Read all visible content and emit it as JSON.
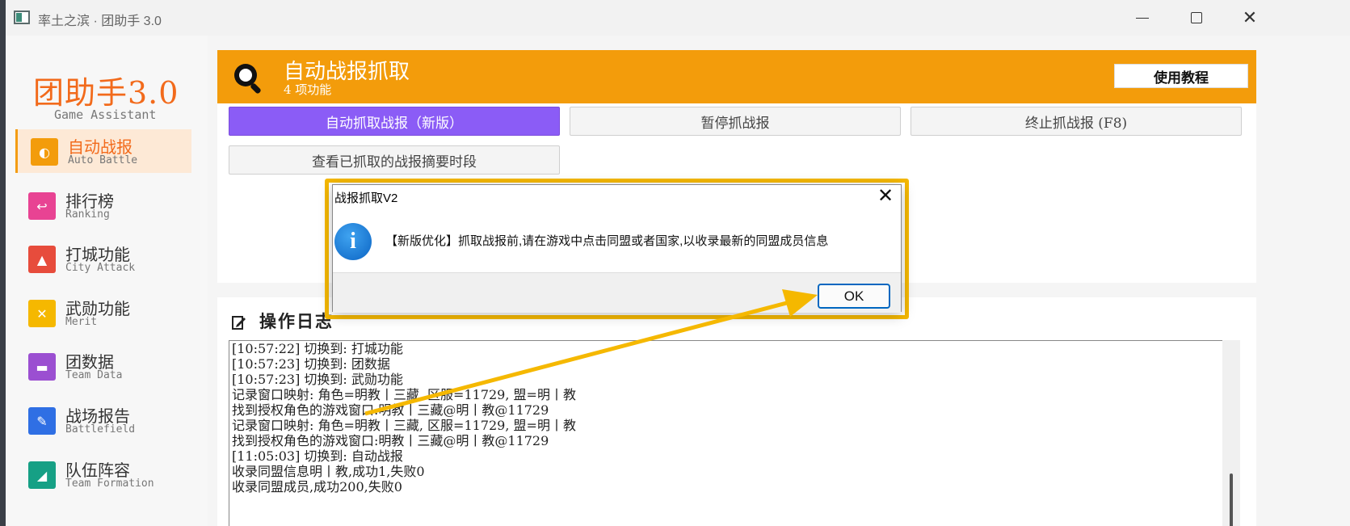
{
  "window": {
    "title": "率土之滨 · 团助手 3.0",
    "controls": {
      "minimize": "minimize",
      "maximize": "maximize",
      "close": "✕"
    }
  },
  "sidebar": {
    "logo_title": "团助手3.0",
    "logo_subtitle": "Game Assistant",
    "items": [
      {
        "label": "自动战报",
        "en": "Auto Battle",
        "color": "#f39c0b",
        "icon": "battle-icon",
        "glyph": "◐",
        "active": true
      },
      {
        "label": "排行榜",
        "en": "Ranking",
        "color": "#e84393",
        "icon": "ranking-icon",
        "glyph": "↩"
      },
      {
        "label": "打城功能",
        "en": "City Attack",
        "color": "#e74c3c",
        "icon": "city-icon",
        "glyph": "▲"
      },
      {
        "label": "武勋功能",
        "en": "Merit",
        "color": "#f5b800",
        "icon": "sword-icon",
        "glyph": "✕"
      },
      {
        "label": "团数据",
        "en": "Team Data",
        "color": "#9b4fd1",
        "icon": "data-icon",
        "glyph": "▬"
      },
      {
        "label": "战场报告",
        "en": "Battlefield",
        "color": "#2f6fe4",
        "icon": "report-icon",
        "glyph": "✎"
      },
      {
        "label": "队伍阵容",
        "en": "Team Formation",
        "color": "#16a085",
        "icon": "formation-icon",
        "glyph": "◢"
      }
    ]
  },
  "header": {
    "title": "自动战报抓取",
    "subtitle": "4 项功能",
    "tutorial_button": "使用教程",
    "color": "#f39c0b"
  },
  "actions": {
    "auto": "自动抓取战报（新版）",
    "pause": "暂停抓战报",
    "stop": "终止抓战报 (F8)",
    "view": "查看已抓取的战报摘要时段"
  },
  "log": {
    "title": "操作日志",
    "lines": [
      "[10:57:22] 切换到: 打城功能",
      "[10:57:23] 切换到: 团数据",
      "[10:57:23] 切换到: 武勋功能",
      "记录窗口映射: 角色=明教丨三藏, 区服=11729, 盟=明丨教",
      "找到授权角色的游戏窗口:明教丨三藏@明丨教@11729",
      "记录窗口映射: 角色=明教丨三藏, 区服=11729, 盟=明丨教",
      "找到授权角色的游戏窗口:明教丨三藏@明丨教@11729",
      "[11:05:03] 切换到: 自动战报",
      "收录同盟信息明丨教,成功1,失败0",
      "收录同盟成员,成功200,失败0"
    ]
  },
  "dialog": {
    "title": "战报抓取V2",
    "message": "【新版优化】抓取战报前,请在游戏中点击同盟或者国家,以收录最新的同盟成员信息",
    "ok": "OK",
    "close": "✕",
    "info_glyph": "i",
    "highlight_color": "#f5b800"
  }
}
